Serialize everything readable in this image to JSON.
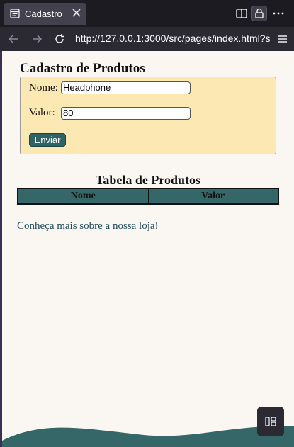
{
  "browser": {
    "tab_title": "Cadastro",
    "url": "http://127.0.0.1:3000/src/pages/index.html?s"
  },
  "page": {
    "title": "Cadastro de Produtos",
    "form": {
      "nome_label": "Nome:",
      "nome_value": "Headphone",
      "valor_label": "Valor:",
      "valor_value": "80",
      "submit_label": "Enviar"
    },
    "table": {
      "title": "Tabela de Produtos",
      "columns": [
        "Nome",
        "Valor"
      ]
    },
    "link_text": "Conheça mais sobre a nossa loja!"
  },
  "colors": {
    "accent": "#356668",
    "form_background": "#fbe8b3",
    "page_background": "#faf6f1"
  },
  "icons": [
    "tab-page-icon",
    "close-icon",
    "sidebar-icon",
    "lock-icon",
    "more-icon",
    "back-icon",
    "forward-icon",
    "reload-icon",
    "menu-icon",
    "widget-icon"
  ]
}
